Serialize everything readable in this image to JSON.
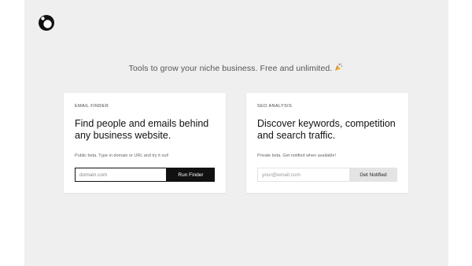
{
  "logo": {
    "icon": "logo-mark-icon"
  },
  "tagline": {
    "text": "Tools to grow your niche business. Free and unlimited.",
    "emoji": "party-popper-icon"
  },
  "cards": {
    "email_finder": {
      "eyebrow": "EMAIL FINDER",
      "title": "Find people and emails behind any business website.",
      "note": "Public beta. Type in domain or URL and try it out!",
      "input_placeholder": "domain.com",
      "button_label": "Run Finder"
    },
    "seo_analysis": {
      "eyebrow": "SEO ANALYSIS",
      "title": "Discover keywords, competition and search traffic.",
      "note": "Private beta. Get notified when available!",
      "input_placeholder": "your@email.com",
      "button_label": "Get Notified"
    }
  },
  "colors": {
    "page_background": "#efefef",
    "card_background": "#ffffff",
    "primary_button": "#111111",
    "secondary_button": "#e4e4e4"
  }
}
